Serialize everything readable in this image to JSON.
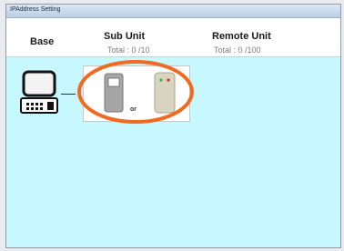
{
  "window": {
    "title": "IPAddress Setting"
  },
  "header": {
    "base_label": "Base",
    "sub_unit": {
      "label": "Sub Unit",
      "total": "Total :  0  /10"
    },
    "remote_unit": {
      "label": "Remote Unit",
      "total": "Total :  0  /100"
    }
  },
  "content": {
    "or_label": "or"
  },
  "colors": {
    "content_bg": "#c8f8ff",
    "highlight_ring": "#f06a22",
    "sub_unit_device": "#a6a6a6",
    "remote_unit_device": "#d8d4c0"
  },
  "icons": [
    "base-station-icon",
    "sub-unit-device-icon",
    "remote-unit-device-icon"
  ]
}
